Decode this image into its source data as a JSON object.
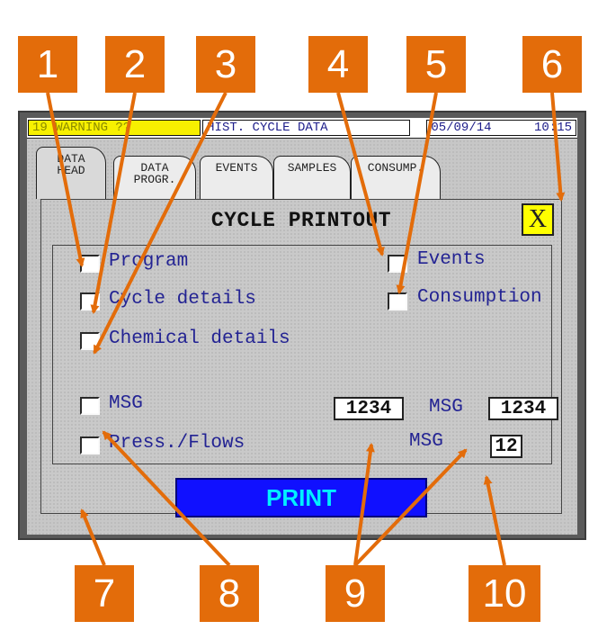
{
  "status_bar": {
    "warning_code": "19",
    "warning_text": "WARNING ??",
    "hist_text": "HIST. CYCLE DATA",
    "date": "05/09/14",
    "time": "10:15"
  },
  "tabs": [
    {
      "label": "DATA\nHEAD",
      "active": true
    },
    {
      "label": "DATA\nPROGR.",
      "active": false
    },
    {
      "label": "EVENTS",
      "active": false
    },
    {
      "label": "SAMPLES",
      "active": false
    },
    {
      "label": "CONSUMP.",
      "active": false
    }
  ],
  "dialog": {
    "title": "CYCLE PRINTOUT",
    "close_label": "X",
    "options": {
      "program": "Program",
      "cycle_details": "Cycle details",
      "chemical_details": "Chemical details",
      "events": "Events",
      "consumption": "Consumption",
      "msg": "MSG",
      "press_flows": "Press./Flows"
    },
    "msg_value_1": "1234",
    "msg_label_2": "MSG",
    "msg_value_2": "1234",
    "msg_label_3": "MSG",
    "msg_value_3": "12",
    "print_label": "PRINT"
  },
  "callouts": [
    "1",
    "2",
    "3",
    "4",
    "5",
    "6",
    "7",
    "8",
    "9",
    "10"
  ],
  "colors": {
    "callout": "#e36c0a",
    "warning_bg": "#f7f000",
    "close_bg": "#ffff00",
    "print_bg": "#1010ff",
    "print_text": "#00f0ff",
    "label_text": "#232393"
  }
}
